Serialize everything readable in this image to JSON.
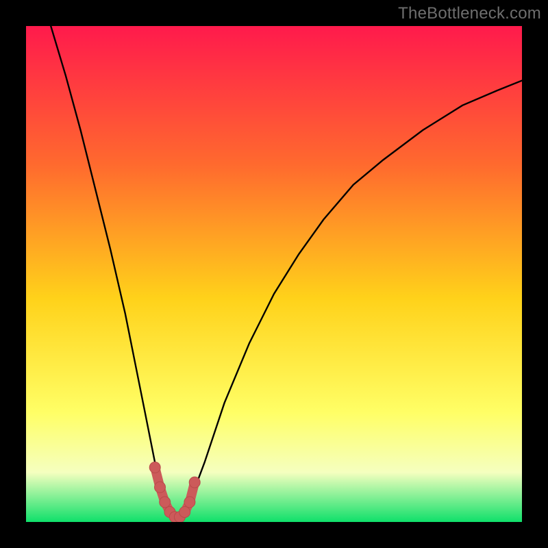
{
  "watermark": "TheBottleneck.com",
  "colors": {
    "frame": "#000000",
    "gradient_top": "#ff1a4c",
    "gradient_mid1": "#ff6a2e",
    "gradient_mid2": "#ffd21a",
    "gradient_mid3": "#ffff66",
    "gradient_mid4": "#f5ffbf",
    "gradient_bottom": "#0fe06a",
    "curve": "#000000",
    "marker_fill": "#cc5a5a",
    "marker_stroke": "#b94a4a"
  },
  "chart_data": {
    "type": "line",
    "title": "",
    "xlabel": "",
    "ylabel": "",
    "xlim": [
      0,
      100
    ],
    "ylim": [
      0,
      100
    ],
    "series": [
      {
        "name": "bottleneck-curve",
        "x": [
          5,
          8,
          11,
          14,
          17,
          20,
          22,
          24,
          26,
          28,
          29.5,
          31,
          33,
          36,
          40,
          45,
          50,
          55,
          60,
          66,
          72,
          80,
          88,
          95,
          100
        ],
        "y": [
          100,
          90,
          79,
          67,
          55,
          42,
          32,
          22,
          12,
          4,
          1,
          1,
          4,
          12,
          24,
          36,
          46,
          54,
          61,
          68,
          73,
          79,
          84,
          87,
          89
        ]
      }
    ],
    "highlight": {
      "name": "optimal-range",
      "x": [
        26,
        27,
        28,
        29,
        30,
        31,
        32,
        33,
        34
      ],
      "y": [
        11,
        7,
        4,
        2,
        1,
        1,
        2,
        4,
        8
      ]
    }
  }
}
